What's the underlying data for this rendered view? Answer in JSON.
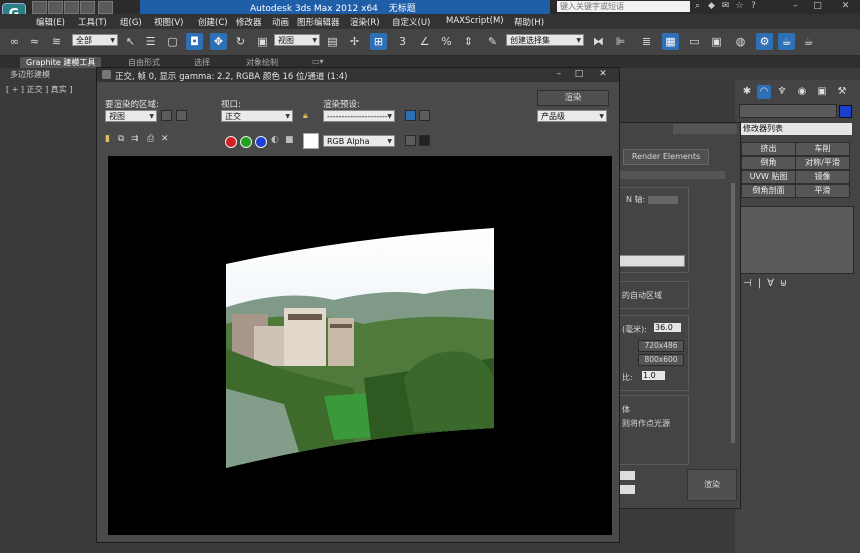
{
  "window": {
    "title": "Autodesk 3ds Max  2012 x64",
    "file": "无标题",
    "search_placeholder": "键入关键字或短语"
  },
  "menu": [
    "编辑(E)",
    "工具(T)",
    "组(G)",
    "视图(V)",
    "创建(C)",
    "修改器",
    "动画",
    "图形编辑器",
    "渲染(R)",
    "自定义(U)",
    "MAXScript(M)",
    "帮助(H)"
  ],
  "toolbar": {
    "filter_dropdown": "全部",
    "reference_dropdown": "视图",
    "selection_set": "创建选择集",
    "snap_label": "3"
  },
  "ribbon": {
    "tabs": [
      "Graphite 建模工具",
      "自由形式",
      "选择",
      "对象绘制"
    ],
    "sub_label": "多边形建模"
  },
  "viewport": {
    "label": "[ + ] 正交 ] 真实 ]"
  },
  "command_panel": {
    "modifier_list": "修改器列表",
    "buttons": [
      "挤出",
      "车削",
      "倒角",
      "对称/平滑",
      "UVW 贴图",
      "镜像",
      "倒角剖面",
      "平滑"
    ]
  },
  "render_setup": {
    "tab": "Render Elements",
    "n_axis_label": "N 轴:",
    "auto_region": "的自动区域",
    "aperture_label": "(毫米):",
    "aperture_value": "36.0",
    "res1": "720x486",
    "res2": "800x600",
    "pixel_ratio_label": "比:",
    "pixel_ratio_value": "1.0",
    "option1": "体",
    "option2": "则将作点光源",
    "render_button": "渲染"
  },
  "frame_window": {
    "title": "正交, 帧 0, 显示 gamma: 2.2, RGBA 颜色 16 位/通道 (1:4)",
    "area_label": "要渲染的区域:",
    "area_value": "视图",
    "viewport_label": "视口:",
    "viewport_value": "正交",
    "preset_label": "渲染预设:",
    "preset_value": "---------------------",
    "render_button": "渲染",
    "quality_value": "产品级",
    "channel_value": "RGB Alpha"
  }
}
